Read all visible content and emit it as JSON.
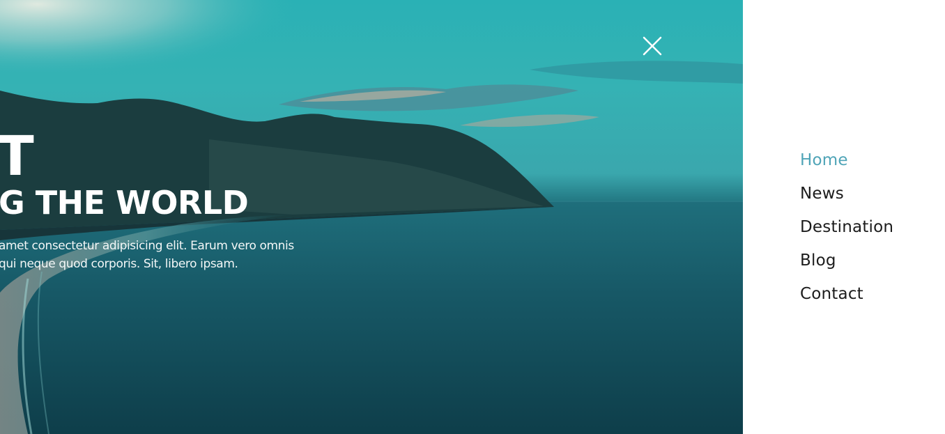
{
  "hero": {
    "title_line_1": "RT",
    "title_line_2": "NG THE WORLD",
    "text_line_1": "amet consectetur adipisicing elit. Earum vero omnis",
    "text_line_2": "qui neque quod corporis. Sit, libero ipsam."
  },
  "close": {
    "icon": "close-icon"
  },
  "menu": {
    "items": [
      {
        "label": "Home",
        "active": true
      },
      {
        "label": "News",
        "active": false
      },
      {
        "label": "Destination",
        "active": false
      },
      {
        "label": "Blog",
        "active": false
      },
      {
        "label": "Contact",
        "active": false
      }
    ],
    "active_color": "#4fa4b7",
    "text_color": "#1c1c1c"
  }
}
